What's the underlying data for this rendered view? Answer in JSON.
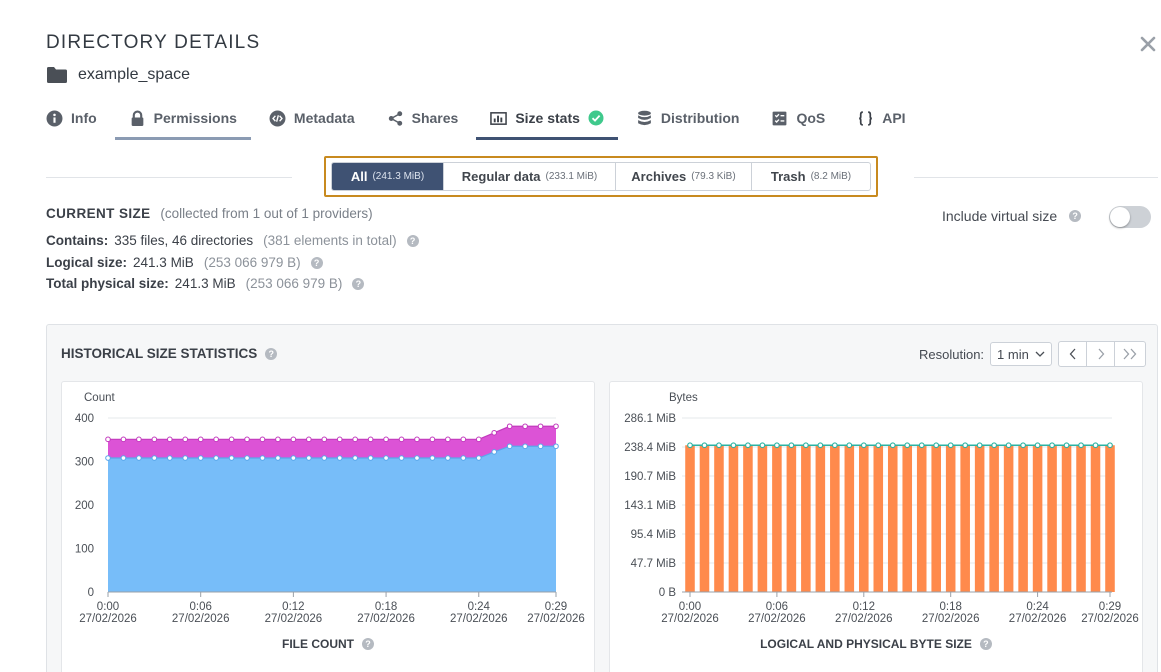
{
  "modal": {
    "title": "DIRECTORY DETAILS",
    "directory_name": "example_space"
  },
  "tabs": [
    {
      "label": "Info",
      "icon": "info-icon"
    },
    {
      "label": "Permissions",
      "icon": "lock-icon"
    },
    {
      "label": "Metadata",
      "icon": "code-icon"
    },
    {
      "label": "Shares",
      "icon": "share-icon"
    },
    {
      "label": "Size stats",
      "icon": "size-stats-icon",
      "status_icon": "check-circle-icon",
      "active": true
    },
    {
      "label": "Distribution",
      "icon": "database-icon"
    },
    {
      "label": "QoS",
      "icon": "qos-icon"
    },
    {
      "label": "API",
      "icon": "braces-icon"
    }
  ],
  "size_filter": [
    {
      "label": "All",
      "sub": "(241.3 MiB)",
      "active": true
    },
    {
      "label": "Regular data",
      "sub": "(233.1 MiB)"
    },
    {
      "label": "Archives",
      "sub": "(79.3 KiB)"
    },
    {
      "label": "Trash",
      "sub": "(8.2 MiB)"
    }
  ],
  "current_size": {
    "heading": "CURRENT SIZE",
    "note": "(collected from 1 out of 1 providers)",
    "contains_label": "Contains:",
    "contains_value": "335 files, 46 directories",
    "contains_note": "(381 elements in total)",
    "logical_label": "Logical size:",
    "logical_value": "241.3 MiB",
    "logical_note": "(253 066 979 B)",
    "physical_label": "Total physical size:",
    "physical_value": "241.3 MiB",
    "physical_note": "(253 066 979 B)"
  },
  "virtual_size": {
    "label": "Include virtual size",
    "enabled": false
  },
  "history": {
    "title": "HISTORICAL SIZE STATISTICS",
    "resolution_label": "Resolution:",
    "resolution_value": "1 min",
    "pager": {
      "prev": "‹",
      "next": "›",
      "last": "»"
    }
  },
  "colors": {
    "accent": "#3f5273",
    "highlight_border": "#c88a1f",
    "file_area": "#77bdf9",
    "dir_area": "#dc53d6",
    "bytes_bar": "#ff8a4c",
    "bytes_line": "#2bb3a3"
  },
  "chart_data": [
    {
      "type": "area",
      "title": "FILE COUNT",
      "ylabel": "Count",
      "ylim": [
        0,
        400
      ],
      "yticks": [
        0,
        100,
        200,
        300,
        400
      ],
      "x_range": [
        "0:00",
        "0:29"
      ],
      "x_ticks": [
        {
          "time": "0:00",
          "date": "27/02/2026"
        },
        {
          "time": "0:06",
          "date": "27/02/2026"
        },
        {
          "time": "0:12",
          "date": "27/02/2026"
        },
        {
          "time": "0:18",
          "date": "27/02/2026"
        },
        {
          "time": "0:24",
          "date": "27/02/2026"
        },
        {
          "time": "0:29",
          "date": "27/02/2026"
        }
      ],
      "stacked": true,
      "series": [
        {
          "values": [
            308,
            308,
            308,
            308,
            308,
            308,
            308,
            308,
            308,
            308,
            308,
            308,
            308,
            308,
            308,
            308,
            308,
            308,
            308,
            308,
            308,
            308,
            308,
            308,
            308,
            322,
            335,
            335,
            335,
            335
          ],
          "color": "#77bdf9"
        },
        {
          "values": [
            351,
            351,
            351,
            351,
            351,
            351,
            351,
            351,
            351,
            351,
            351,
            351,
            351,
            351,
            351,
            351,
            351,
            351,
            351,
            351,
            351,
            351,
            351,
            351,
            351,
            366,
            381,
            381,
            381,
            381
          ],
          "color": "#dc53d6"
        }
      ]
    },
    {
      "type": "bar",
      "title": "LOGICAL AND PHYSICAL BYTE SIZE",
      "ylabel": "Bytes",
      "yticks": [
        "0 B",
        "47.7 MiB",
        "95.4 MiB",
        "143.1 MiB",
        "190.7 MiB",
        "238.4 MiB",
        "286.1 MiB"
      ],
      "ylim_mib": [
        0,
        286.1
      ],
      "x_range": [
        "0:00",
        "0:29"
      ],
      "x_ticks": [
        {
          "time": "0:00",
          "date": "27/02/2026"
        },
        {
          "time": "0:06",
          "date": "27/02/2026"
        },
        {
          "time": "0:12",
          "date": "27/02/2026"
        },
        {
          "time": "0:18",
          "date": "27/02/2026"
        },
        {
          "time": "0:24",
          "date": "27/02/2026"
        },
        {
          "time": "0:29",
          "date": "27/02/2026"
        }
      ],
      "series": [
        {
          "values_mib": [
            241.3,
            241.3,
            241.3,
            241.3,
            241.3,
            241.3,
            241.3,
            241.3,
            241.3,
            241.3,
            241.3,
            241.3,
            241.3,
            241.3,
            241.3,
            241.3,
            241.3,
            241.3,
            241.3,
            241.3,
            241.3,
            241.3,
            241.3,
            241.3,
            241.3,
            241.3,
            241.3,
            241.3,
            241.3,
            241.3
          ],
          "color": "#ff8a4c",
          "mark": "bar"
        },
        {
          "values_mib": [
            241.3,
            241.3,
            241.3,
            241.3,
            241.3,
            241.3,
            241.3,
            241.3,
            241.3,
            241.3,
            241.3,
            241.3,
            241.3,
            241.3,
            241.3,
            241.3,
            241.3,
            241.3,
            241.3,
            241.3,
            241.3,
            241.3,
            241.3,
            241.3,
            241.3,
            241.3,
            241.3,
            241.3,
            241.3,
            241.3
          ],
          "color": "#2bb3a3",
          "mark": "line"
        }
      ]
    }
  ]
}
